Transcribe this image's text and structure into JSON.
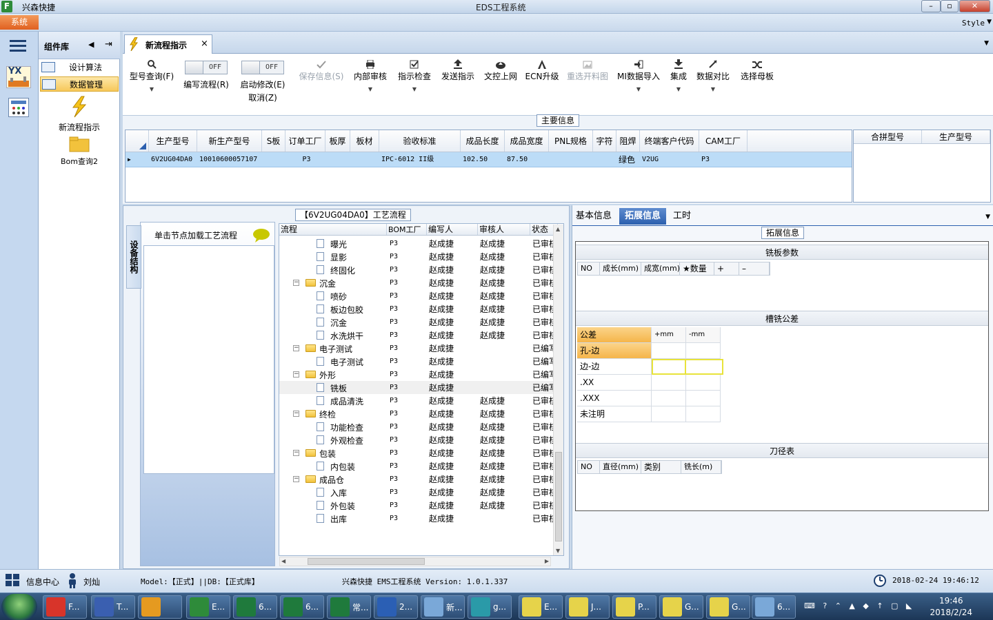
{
  "window": {
    "app_name": "兴森快捷",
    "title": "EDS工程系统",
    "minimize": "–",
    "restore": "▫",
    "close": "✕"
  },
  "menu": {
    "system": "系统",
    "style": "Style"
  },
  "rail": {
    "menu_icon": "hamburger-icon",
    "yx_label": "YX"
  },
  "sidebar": {
    "title": "组件库",
    "items": [
      {
        "label": "设计算法"
      },
      {
        "label": "数据管理"
      }
    ],
    "big_items": [
      {
        "label": "新流程指示"
      },
      {
        "label": "Bom查询2"
      }
    ]
  },
  "tab": {
    "label": "新流程指示",
    "close": "×"
  },
  "toolbar": {
    "query": "型号查询(F)",
    "edit_flow": {
      "toggle": "OFF",
      "label": "编写流程(R)"
    },
    "start_modify": {
      "toggle": "OFF",
      "label": "启动修改(E)",
      "sub": "取消(Z)"
    },
    "save": "保存信息(S)",
    "internal_review": "内部审核",
    "instr_check": "指示检查",
    "send_instr": "发送指示",
    "doc_upload": "文控上网",
    "ecn": "ECN升级",
    "reselect": "重选开料图",
    "mi_import": "MI数据导入",
    "integrate": "集成",
    "compare": "数据对比",
    "select_mother": "选择母板"
  },
  "main_info": {
    "title": "主要信息",
    "columns": [
      "生产型号",
      "新生产型号",
      "S板",
      "订单工厂",
      "板厚",
      "板材",
      "验收标准",
      "成品长度",
      "成品宽度",
      "PNL规格",
      "字符",
      "阻焊",
      "终端客户代码",
      "CAM工厂"
    ],
    "row": [
      "6V2UG04DA0",
      "10010600057107",
      "",
      "P3",
      "",
      "",
      "IPC-6012 II级",
      "102.50",
      "87.50",
      "",
      "",
      "绿色",
      "V2UG",
      "P3"
    ],
    "side_columns": [
      "合拼型号",
      "生产型号"
    ]
  },
  "process": {
    "title": "【6V2UG04DA0】工艺流程",
    "vtab": "设备结构",
    "node_hint": "单击节点加载工艺流程",
    "columns": [
      "流程",
      "BOM工厂",
      "编写人",
      "审核人",
      "状态"
    ],
    "rows": [
      {
        "level": 2,
        "type": "doc",
        "name": "曝光",
        "bom": "P3",
        "writer": "赵成捷",
        "reviewer": "赵成捷",
        "status": "已审核"
      },
      {
        "level": 2,
        "type": "doc",
        "name": "显影",
        "bom": "P3",
        "writer": "赵成捷",
        "reviewer": "赵成捷",
        "status": "已审核"
      },
      {
        "level": 2,
        "type": "doc",
        "name": "终固化",
        "bom": "P3",
        "writer": "赵成捷",
        "reviewer": "赵成捷",
        "status": "已审核"
      },
      {
        "level": 1,
        "type": "folder",
        "name": "沉金",
        "bom": "P3",
        "writer": "赵成捷",
        "reviewer": "赵成捷",
        "status": "已审核"
      },
      {
        "level": 2,
        "type": "doc",
        "name": "喷砂",
        "bom": "P3",
        "writer": "赵成捷",
        "reviewer": "赵成捷",
        "status": "已审核"
      },
      {
        "level": 2,
        "type": "doc",
        "name": "板边包胶",
        "bom": "P3",
        "writer": "赵成捷",
        "reviewer": "赵成捷",
        "status": "已审核"
      },
      {
        "level": 2,
        "type": "doc",
        "name": "沉金",
        "bom": "P3",
        "writer": "赵成捷",
        "reviewer": "赵成捷",
        "status": "已审核"
      },
      {
        "level": 2,
        "type": "doc",
        "name": "水洗烘干",
        "bom": "P3",
        "writer": "赵成捷",
        "reviewer": "赵成捷",
        "status": "已审核"
      },
      {
        "level": 1,
        "type": "folder",
        "name": "电子测试",
        "bom": "P3",
        "writer": "赵成捷",
        "reviewer": "",
        "status": "已编写"
      },
      {
        "level": 2,
        "type": "doc",
        "name": "电子测试",
        "bom": "P3",
        "writer": "赵成捷",
        "reviewer": "",
        "status": "已编写"
      },
      {
        "level": 1,
        "type": "folder",
        "name": "外形",
        "bom": "P3",
        "writer": "赵成捷",
        "reviewer": "",
        "status": "已编写"
      },
      {
        "level": 2,
        "type": "doc",
        "name": "铣板",
        "bom": "P3",
        "writer": "赵成捷",
        "reviewer": "",
        "status": "已编写",
        "selected": true
      },
      {
        "level": 2,
        "type": "doc",
        "name": "成品清洗",
        "bom": "P3",
        "writer": "赵成捷",
        "reviewer": "赵成捷",
        "status": "已审核"
      },
      {
        "level": 1,
        "type": "folder",
        "name": "终检",
        "bom": "P3",
        "writer": "赵成捷",
        "reviewer": "赵成捷",
        "status": "已审核"
      },
      {
        "level": 2,
        "type": "doc",
        "name": "功能检查",
        "bom": "P3",
        "writer": "赵成捷",
        "reviewer": "赵成捷",
        "status": "已审核"
      },
      {
        "level": 2,
        "type": "doc",
        "name": "外观检查",
        "bom": "P3",
        "writer": "赵成捷",
        "reviewer": "赵成捷",
        "status": "已审核"
      },
      {
        "level": 1,
        "type": "folder",
        "name": "包装",
        "bom": "P3",
        "writer": "赵成捷",
        "reviewer": "赵成捷",
        "status": "已审核"
      },
      {
        "level": 2,
        "type": "doc",
        "name": "内包装",
        "bom": "P3",
        "writer": "赵成捷",
        "reviewer": "赵成捷",
        "status": "已审核"
      },
      {
        "level": 1,
        "type": "folder",
        "name": "成品仓",
        "bom": "P3",
        "writer": "赵成捷",
        "reviewer": "赵成捷",
        "status": "已审核"
      },
      {
        "level": 2,
        "type": "doc",
        "name": "入库",
        "bom": "P3",
        "writer": "赵成捷",
        "reviewer": "赵成捷",
        "status": "已审核"
      },
      {
        "level": 2,
        "type": "doc",
        "name": "外包装",
        "bom": "P3",
        "writer": "赵成捷",
        "reviewer": "赵成捷",
        "status": "已审核"
      },
      {
        "level": 2,
        "type": "doc",
        "name": "出库",
        "bom": "P3",
        "writer": "赵成捷",
        "reviewer": "",
        "status": "已审核"
      }
    ]
  },
  "right": {
    "tabs": [
      "基本信息",
      "拓展信息",
      "工时"
    ],
    "ext_title": "拓展信息",
    "mill_params": {
      "title": "铣板参数",
      "columns": [
        "NO",
        "成长(mm)",
        "成宽(mm)",
        "★数量",
        "+",
        "–"
      ]
    },
    "tolerance": {
      "title": "槽铣公差",
      "header": [
        "公差",
        "+mm",
        "-mm"
      ],
      "rows": [
        "孔-边",
        "边-边",
        ".XX",
        ".XXX",
        "未注明"
      ]
    },
    "tools": {
      "title": "刀径表",
      "columns": [
        "NO",
        "直径(mm)",
        "类别",
        "铣长(m)"
      ]
    }
  },
  "status": {
    "info_center": "信息中心",
    "user": "刘灿",
    "model": "Model:【正式】||DB:【正式库】",
    "version": "兴森快捷 EMS工程系统 Version: 1.0.1.337",
    "datetime": "2018-02-24 19:46:12"
  },
  "taskbar": {
    "tasks": [
      {
        "label": "F...",
        "color": "#d8342a"
      },
      {
        "label": "T...",
        "color": "#3a5fb0"
      },
      {
        "label": "",
        "color": "#e59a20"
      },
      {
        "label": "E...",
        "color": "#2e8b3a"
      },
      {
        "label": "6...",
        "color": "#1f7a3c"
      },
      {
        "label": "6...",
        "color": "#1f7a3c"
      },
      {
        "label": "常...",
        "color": "#1f7a3c"
      },
      {
        "label": "2...",
        "color": "#2b5fb4"
      },
      {
        "label": "新...",
        "color": "#7aa8d8"
      },
      {
        "label": "g...",
        "color": "#2a9aa8"
      },
      {
        "label": "E...",
        "color": "#e6d34a"
      },
      {
        "label": "J...",
        "color": "#e6d34a"
      },
      {
        "label": "P...",
        "color": "#e6d34a"
      },
      {
        "label": "G...",
        "color": "#e6d34a"
      },
      {
        "label": "G...",
        "color": "#e6d34a"
      },
      {
        "label": "6...",
        "color": "#7aa8d8"
      }
    ],
    "time": "19:46",
    "date": "2018/2/24"
  },
  "colors": {
    "accent": "#2b5fae",
    "system_menu": "#e06020",
    "selection_row": "#bcdcf7",
    "highlight_cell": "#e8e33a"
  }
}
